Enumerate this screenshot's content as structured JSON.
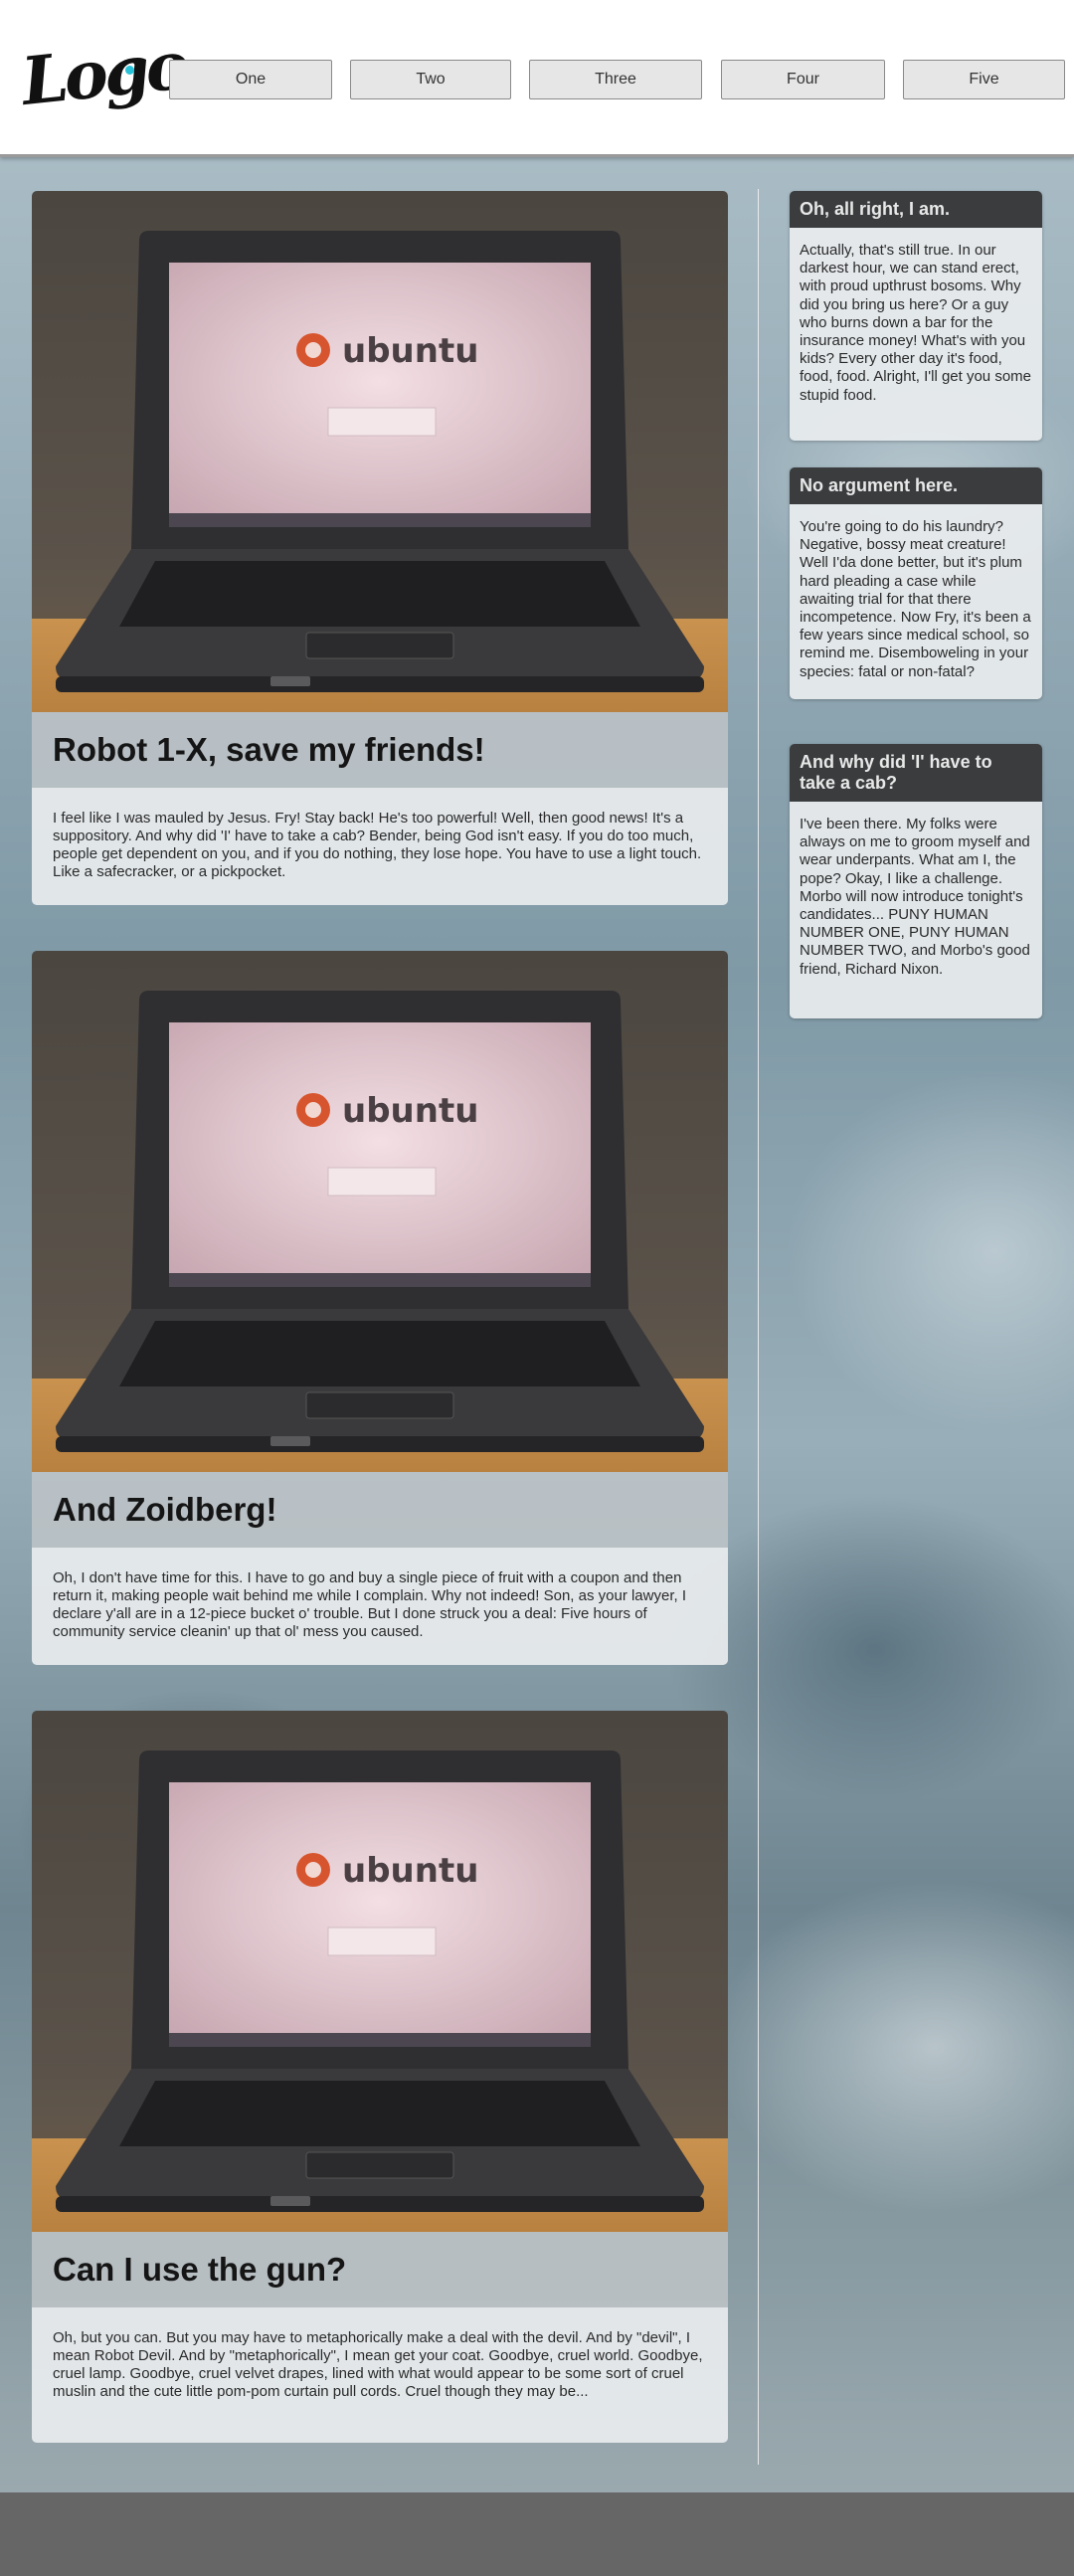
{
  "header": {
    "logo_text": "Logo",
    "nav": [
      "One",
      "Two",
      "Three",
      "Four",
      "Five"
    ]
  },
  "colors": {
    "header_bg": "#ffffff",
    "widget_title_bg": "#3a3c3e",
    "footer_bg": "#666666",
    "logo_dot": "#27c2d8"
  },
  "posts": [
    {
      "title": "Robot 1-X, save my friends!",
      "text": "I feel like I was mauled by Jesus. Fry! Stay back! He's too powerful! Well, then good news! It's a suppository. And why did 'I' have to take a cab? Bender, being God isn't easy. If you do too much, people get dependent on you, and if you do nothing, they lose hope. You have to use a light touch. Like a safecracker, or a pickpocket.",
      "image_brand": "ubuntu",
      "image_icon": "laptop-photo"
    },
    {
      "title": "And Zoidberg!",
      "text": "Oh, I don't have time for this. I have to go and buy a single piece of fruit with a coupon and then return it, making people wait behind me while I complain. Why not indeed! Son, as your lawyer, I declare y'all are in a 12-piece bucket o' trouble. But I done struck you a deal: Five hours of community service cleanin' up that ol' mess you caused.",
      "image_brand": "ubuntu",
      "image_icon": "laptop-photo"
    },
    {
      "title": "Can I use the gun?",
      "text": "Oh, but you can. But you may have to metaphorically make a deal with the devil. And by \"devil\", I mean Robot Devil. And by \"metaphorically\", I mean get your coat. Goodbye, cruel world. Goodbye, cruel lamp. Goodbye, cruel velvet drapes, lined with what would appear to be some sort of cruel muslin and the cute little pom-pom curtain pull cords. Cruel though they may be...",
      "image_brand": "ubuntu",
      "image_icon": "laptop-photo"
    }
  ],
  "sidebar": [
    {
      "title": "Oh, all right, I am.",
      "text": "Actually, that's still true. In our darkest hour, we can stand erect, with proud upthrust bosoms. Why did you bring us here? Or a guy who burns down a bar for the insurance money! What's with you kids? Every other day it's food, food, food. Alright, I'll get you some stupid food."
    },
    {
      "title": "No argument here.",
      "text": "You're going to do his laundry? Negative, bossy meat creature! Well I'da done better, but it's plum hard pleading a case while awaiting trial for that there incompetence. Now Fry, it's been a few years since medical school, so remind me. Disemboweling in your species: fatal or non-fatal?"
    },
    {
      "title": "And why did 'I' have to take a cab?",
      "text": "I've been there. My folks were always on me to groom myself and wear underpants. What am I, the pope? Okay, I like a challenge. Morbo will now introduce tonight's candidates... PUNY HUMAN NUMBER ONE, PUNY HUMAN NUMBER TWO, and Morbo's good friend, Richard Nixon."
    }
  ]
}
